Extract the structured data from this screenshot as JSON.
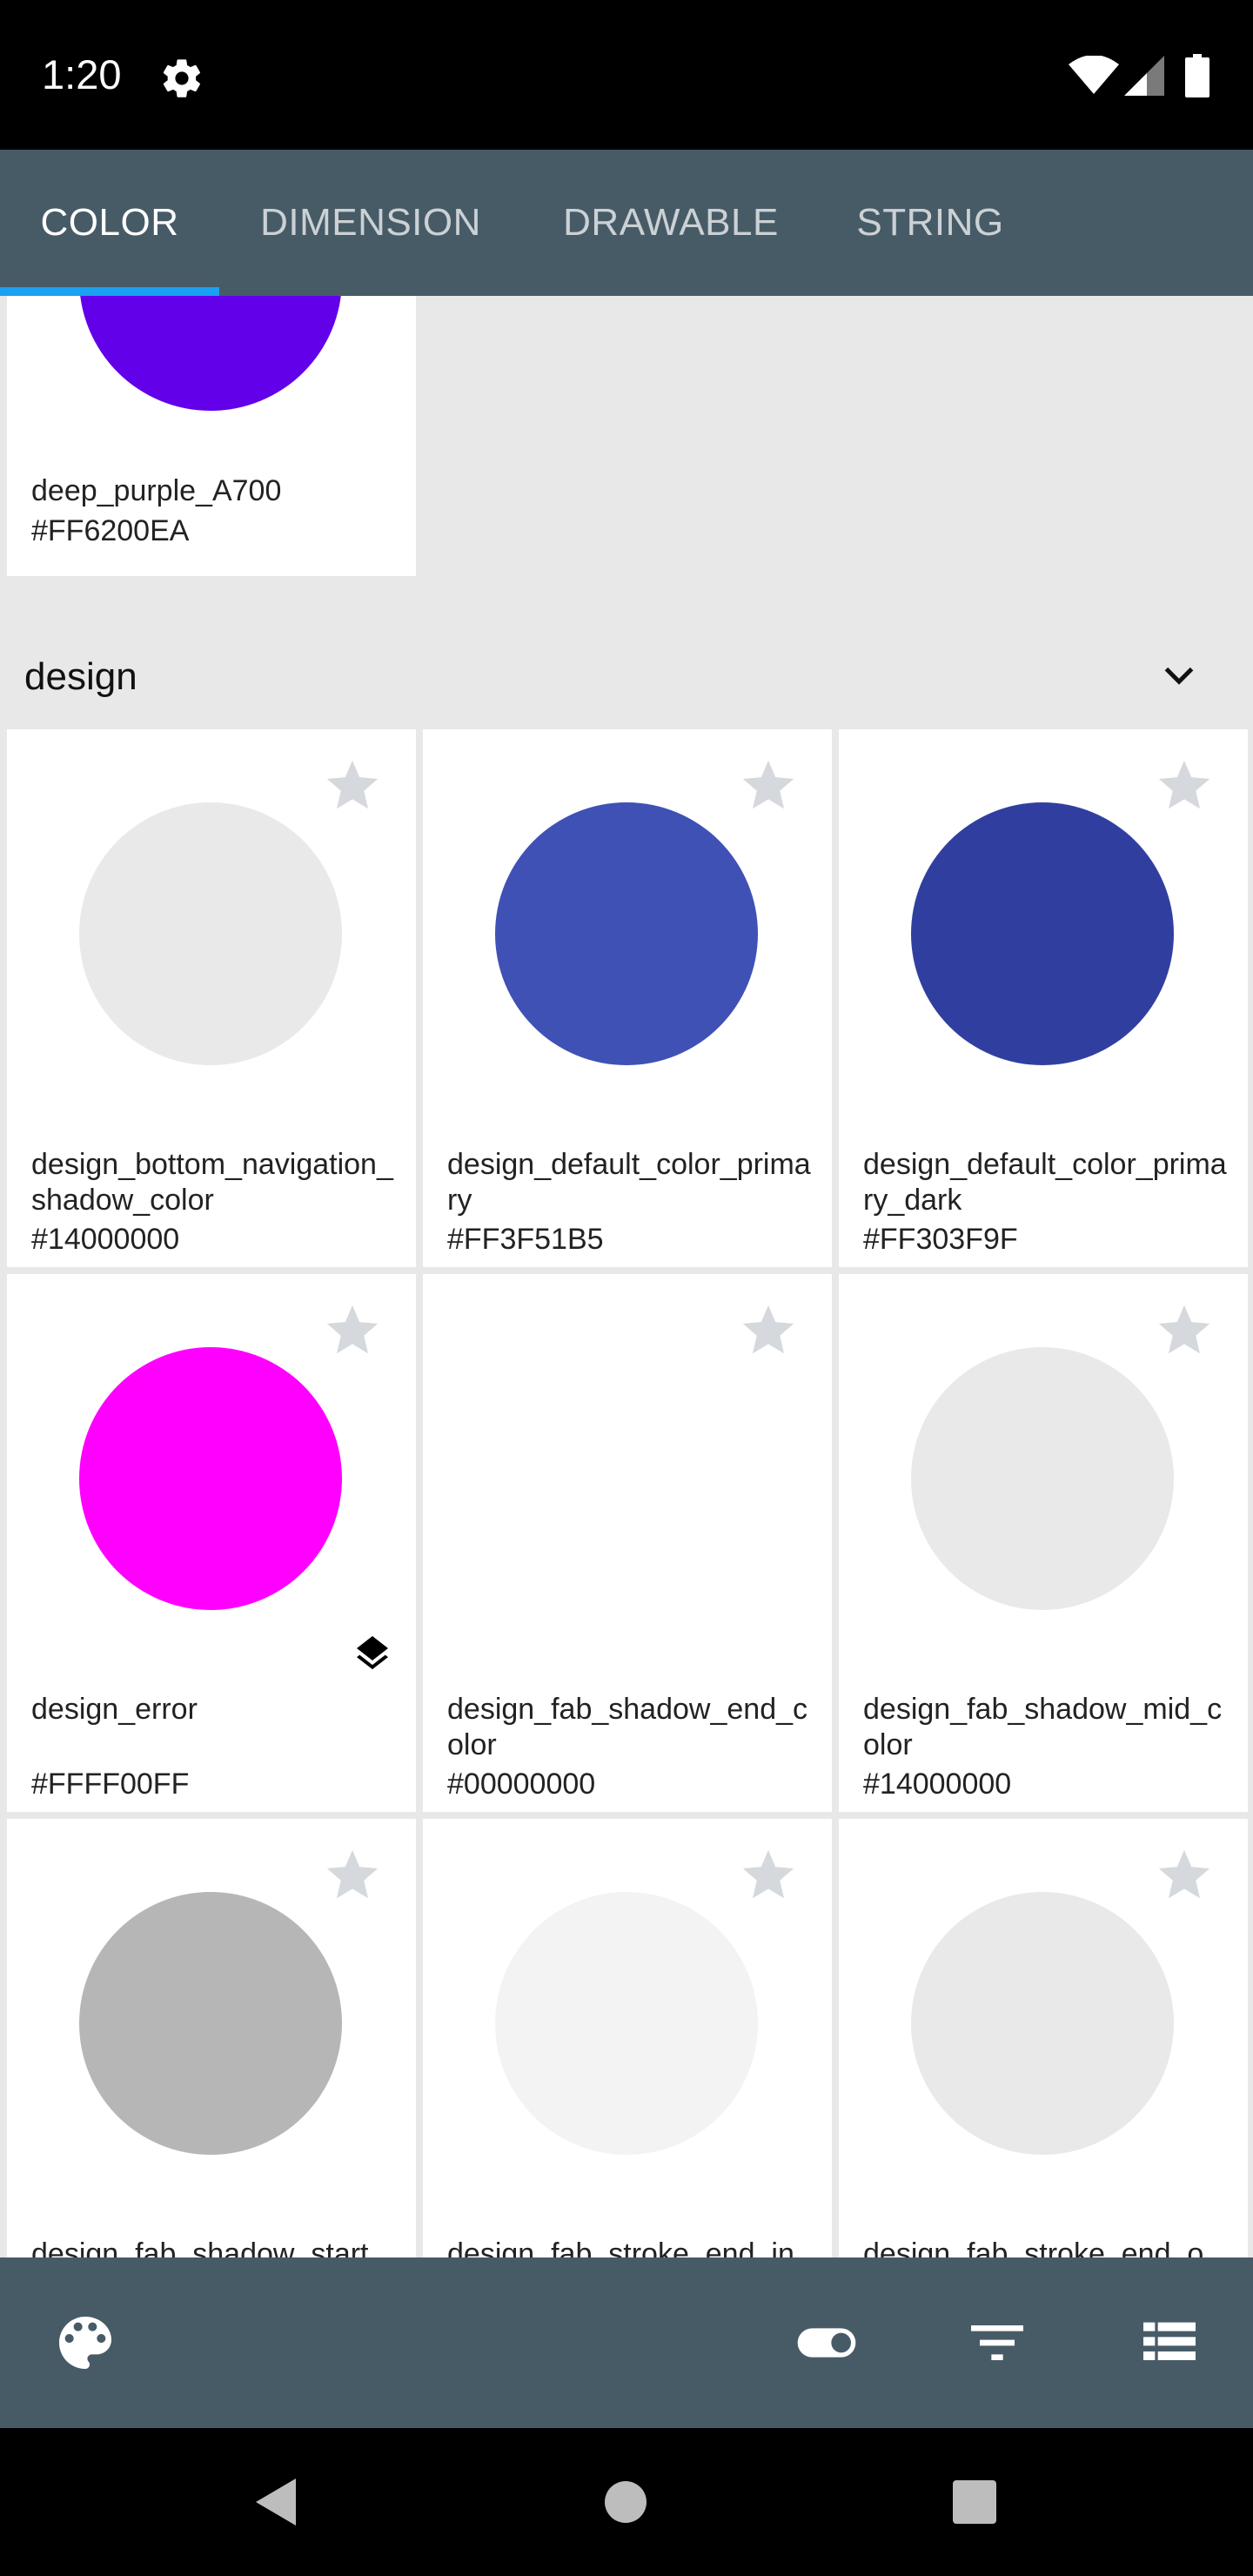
{
  "status_bar": {
    "time": "1:20"
  },
  "tabs": [
    {
      "label": "COLOR",
      "active": true
    },
    {
      "label": "DIMENSION",
      "active": false
    },
    {
      "label": "DRAWABLE",
      "active": false
    },
    {
      "label": "STRING",
      "active": false
    }
  ],
  "colors": {
    "tab_bar_bg": "#475b67",
    "tab_indicator": "#1ba1f2",
    "star": "#d5d8dc"
  },
  "top_card": {
    "name": "deep_purple_A700",
    "hex": "#FF6200EA",
    "swatch": "#6200EA"
  },
  "section": {
    "title": "design",
    "icon": "chevron-down-icon"
  },
  "cards": [
    {
      "name": "design_bottom_navigation_shadow_color",
      "hex": "#14000000",
      "swatch": "#e9e9e9"
    },
    {
      "name": "design_default_color_primary",
      "hex": "#FF3F51B5",
      "swatch": "#3f51b5"
    },
    {
      "name": "design_default_color_primary_dark",
      "hex": "#FF303F9F",
      "swatch": "#303f9f"
    },
    {
      "name": "design_error",
      "hex": "#FFFF00FF",
      "swatch": "#ff00ff",
      "has_stack_icon": true
    },
    {
      "name": "design_fab_shadow_end_color",
      "hex": "#00000000",
      "swatch": "#ffffff"
    },
    {
      "name": "design_fab_shadow_mid_color",
      "hex": "#14000000",
      "swatch": "#e9e9e9"
    },
    {
      "name": "design_fab_shadow_start_",
      "hex": "",
      "swatch": "#b6b6b6"
    },
    {
      "name": "design_fab_stroke_end_in",
      "hex": "",
      "swatch": "#f3f3f3"
    },
    {
      "name": "design_fab_stroke_end_o",
      "hex": "",
      "swatch": "#e9e9e9"
    }
  ],
  "bottom_bar": {
    "icons": [
      "palette-icon",
      "toggle-icon",
      "filter-icon",
      "list-view-icon"
    ]
  },
  "nav_bar": {
    "icons": [
      "back-icon",
      "home-icon",
      "recents-icon"
    ]
  }
}
